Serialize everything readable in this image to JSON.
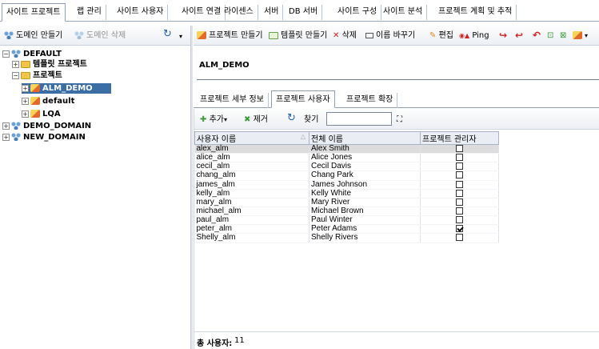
{
  "main_tabs": [
    {
      "label": "사이트 프로젝트",
      "active": true
    },
    {
      "label": "랩 관리"
    },
    {
      "label": "사이트 사용자"
    },
    {
      "label": "사이트 연결"
    },
    {
      "label": "라이센스"
    },
    {
      "label": "서버"
    },
    {
      "label": "DB 서버"
    },
    {
      "label": "사이트 구성"
    },
    {
      "label": "사이트 분석"
    },
    {
      "label": "프로젝트 계획 및 추적"
    }
  ],
  "left_toolbar": {
    "create_domain": "도메인 만들기",
    "delete_domain": "도메인 삭제"
  },
  "tree": {
    "nodes": [
      {
        "label": "DEFAULT",
        "level": 0,
        "expander": "⊟",
        "icon": "domain-icon"
      },
      {
        "label": "템플릿 프로젝트",
        "level": 1,
        "expander": "⊞",
        "icon": "folder-icon"
      },
      {
        "label": "프로젝트",
        "level": 1,
        "expander": "⊟",
        "icon": "folder-icon"
      },
      {
        "label": "ALM_DEMO",
        "level": 2,
        "expander": "⊞",
        "icon": "project-icon",
        "selected": true
      },
      {
        "label": "default",
        "level": 2,
        "expander": "⊞",
        "icon": "project-icon"
      },
      {
        "label": "LQA",
        "level": 2,
        "expander": "⊞",
        "icon": "project-icon"
      },
      {
        "label": "DEMO_DOMAIN",
        "level": 0,
        "expander": "⊞",
        "icon": "domain-icon"
      },
      {
        "label": "NEW_DOMAIN",
        "level": 0,
        "expander": "⊞",
        "icon": "domain-icon"
      }
    ]
  },
  "right_toolbar": {
    "create_project": "프로젝트 만들기",
    "create_template": "템플릿 만들기",
    "delete": "삭제",
    "rename": "이름 바꾸기",
    "edit": "편집",
    "ping": "Ping"
  },
  "project": {
    "title": "ALM_DEMO"
  },
  "sub_tabs": [
    {
      "label": "프로젝트 세부 정보"
    },
    {
      "label": "프로젝트 사용자",
      "active": true
    },
    {
      "label": "프로젝트 확장"
    }
  ],
  "grid_toolbar": {
    "add": "추가",
    "remove": "제거",
    "find": "찾기",
    "find_value": ""
  },
  "users_table": {
    "columns": [
      "사용자 이름",
      "전체 이름",
      "프로젝트 관리자"
    ],
    "rows": [
      {
        "username": "alex_alm",
        "fullname": "Alex Smith",
        "admin": false,
        "selected": true
      },
      {
        "username": "alice_alm",
        "fullname": "Alice Jones",
        "admin": false
      },
      {
        "username": "cecil_alm",
        "fullname": "Cecil Davis",
        "admin": false
      },
      {
        "username": "chang_alm",
        "fullname": "Chang Park",
        "admin": false
      },
      {
        "username": "james_alm",
        "fullname": "James Johnson",
        "admin": false
      },
      {
        "username": "kelly_alm",
        "fullname": "Kelly White",
        "admin": false
      },
      {
        "username": "mary_alm",
        "fullname": "Mary River",
        "admin": false
      },
      {
        "username": "michael_alm",
        "fullname": "Michael Brown",
        "admin": false
      },
      {
        "username": "paul_alm",
        "fullname": "Paul Winter",
        "admin": false
      },
      {
        "username": "peter_alm",
        "fullname": "Peter Adams",
        "admin": true
      },
      {
        "username": "Shelly_alm",
        "fullname": "Shelly Rivers",
        "admin": false
      }
    ]
  },
  "footer": {
    "total_label": "총 사용자:",
    "total_value": "11"
  }
}
